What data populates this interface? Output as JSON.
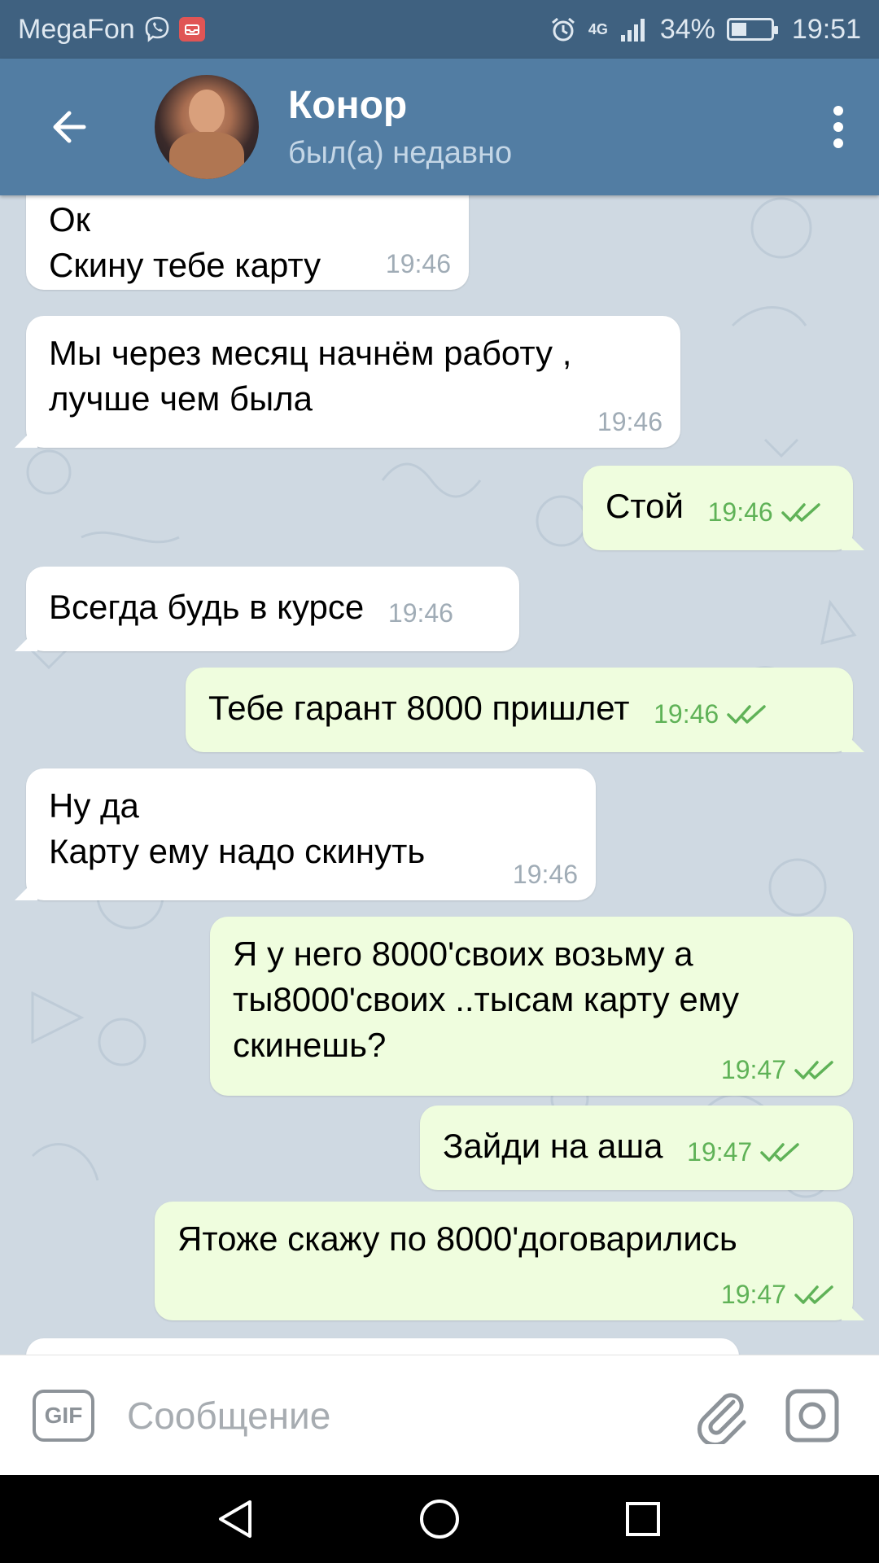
{
  "status_bar": {
    "carrier": "MegaFon",
    "network": "4G",
    "battery": "34%",
    "battery_level": 0.34,
    "time": "19:51"
  },
  "header": {
    "contact_name": "Конор",
    "contact_status": "был(а) недавно"
  },
  "messages": [
    {
      "direction": "in",
      "text": "Ок\nСкину тебе карту",
      "time": "19:46"
    },
    {
      "direction": "in",
      "text": "Мы через месяц начнём работу ,\nлучше чем была",
      "time": "19:46"
    },
    {
      "direction": "out",
      "text": "Стой",
      "time": "19:46",
      "read": true
    },
    {
      "direction": "in",
      "text": "Всегда будь в курсе",
      "time": "19:46"
    },
    {
      "direction": "out",
      "text": "Тебе гарант 8000 пришлет",
      "time": "19:46",
      "read": true
    },
    {
      "direction": "in",
      "text": "Ну да\nКарту ему надо скинуть",
      "time": "19:46"
    },
    {
      "direction": "out",
      "text": "Я у него 8000'своих возьму а\nты8000'своих ..тысам карту ему\nскинешь?",
      "time": "19:47",
      "read": true
    },
    {
      "direction": "out",
      "text": "Зайди на аша",
      "time": "19:47",
      "read": true
    },
    {
      "direction": "out",
      "text": "Ятоже скажу по 8000'договарились",
      "time": "19:47",
      "read": true
    }
  ],
  "composer": {
    "gif_label": "GIF",
    "placeholder": "Сообщение"
  },
  "colors": {
    "header": "#527da3",
    "status_bar": "#3f6180",
    "chat_bg": "#cfd9e2",
    "outgoing_bubble": "#effdde",
    "incoming_bubble": "#ffffff",
    "read_check": "#5fb257"
  },
  "icons": {
    "back": "arrow-left-icon",
    "menu": "more-vertical-icon",
    "attach": "paperclip-icon",
    "camera": "camera-icon",
    "nav_back": "triangle-back-icon",
    "nav_home": "circle-home-icon",
    "nav_recent": "square-recent-icon"
  }
}
